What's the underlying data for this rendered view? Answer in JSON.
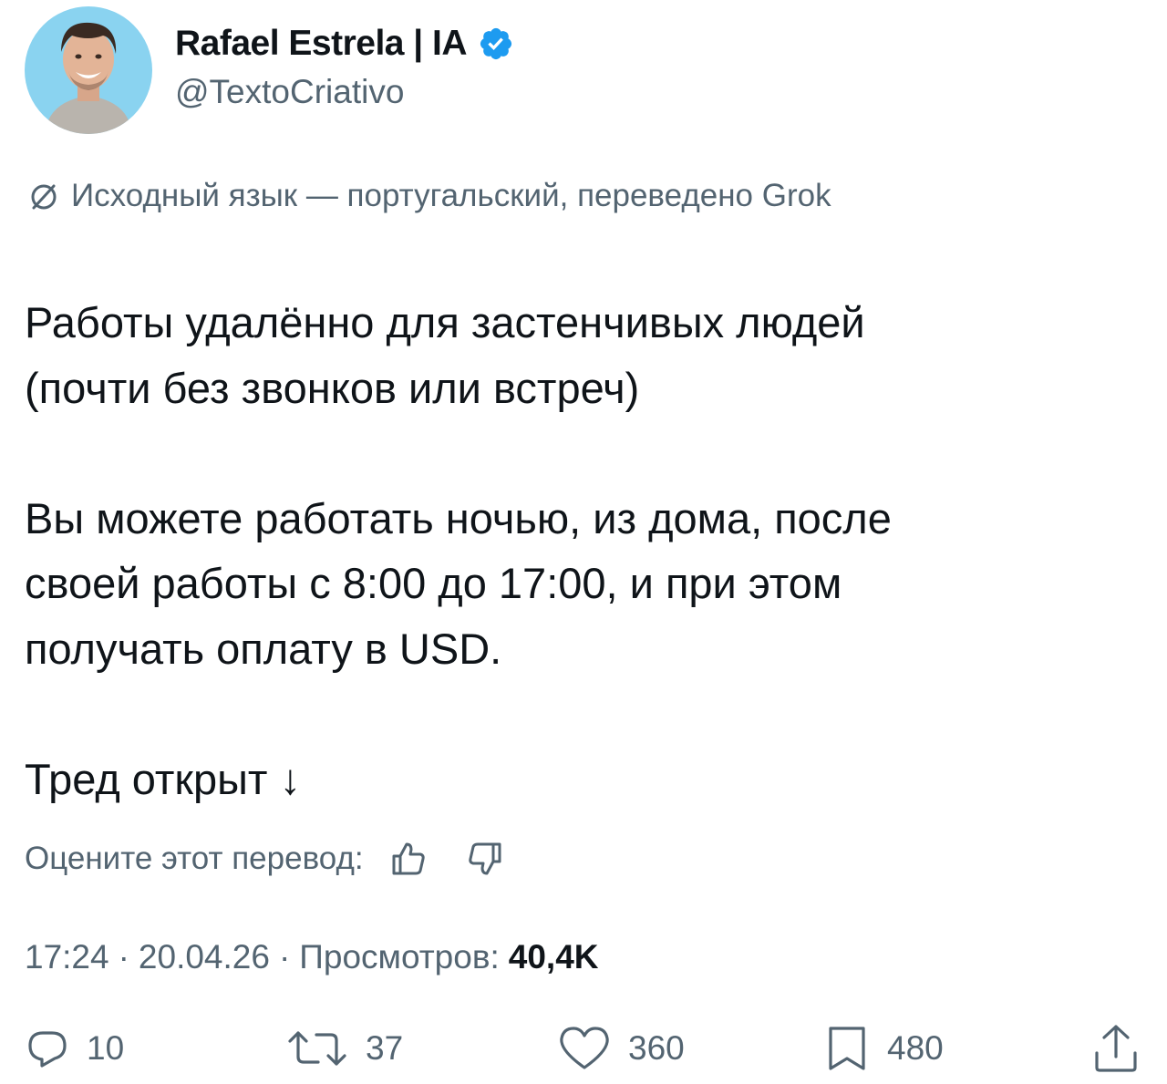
{
  "author": {
    "display_name": "Rafael Estrela | IA",
    "handle": "@TextoCriativo",
    "verified_icon": "verified-badge-icon",
    "verified_color": "#1d9bf0",
    "avatar_background": "#8ad3f0"
  },
  "translation_note": "Исходный язык — португальский, переведено Grok",
  "tweet": {
    "text": "Работы удалённо для застенчивых людей\n(почти без звонков или встреч)\n\nВы можете работать ночью, из дома, после\nсвоей работы с 8:00 до 17:00, и при этом\nполучать оплату в USD.\n\nТред открыт ↓"
  },
  "rate_translation": {
    "label": "Оцените этот перевод:",
    "up_icon": "thumbs-up-icon",
    "down_icon": "thumbs-down-icon"
  },
  "meta": {
    "time": "17:24",
    "date": "20.04.26",
    "separator": "·",
    "views_label": "Просмотров:",
    "views_count": "40,4K"
  },
  "actions": [
    {
      "name": "reply",
      "icon": "reply-icon",
      "count": "10"
    },
    {
      "name": "retweet",
      "icon": "retweet-icon",
      "count": "37"
    },
    {
      "name": "like",
      "icon": "heart-icon",
      "count": "360"
    },
    {
      "name": "bookmark",
      "icon": "bookmark-icon",
      "count": "480"
    },
    {
      "name": "share",
      "icon": "share-icon",
      "count": ""
    }
  ],
  "colors": {
    "text_primary": "#0f1419",
    "text_secondary": "#536471",
    "accent": "#1d9bf0"
  }
}
